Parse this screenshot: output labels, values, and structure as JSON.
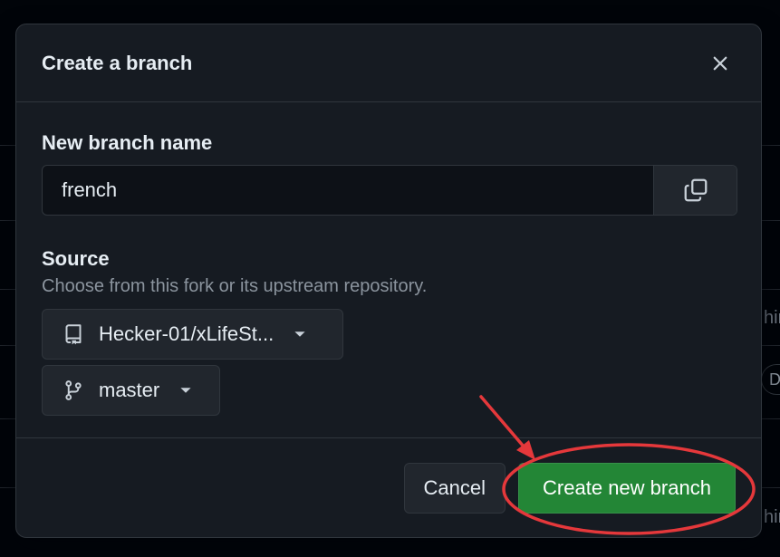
{
  "background": {
    "fragment_1": "hir",
    "fragment_2": "D",
    "fragment_3": "hir"
  },
  "dialog": {
    "title": "Create a branch",
    "close_icon": "x-icon"
  },
  "branch_name": {
    "label": "New branch name",
    "value": "french",
    "copy_icon": "copy-icon"
  },
  "source": {
    "label": "Source",
    "help": "Choose from this fork or its upstream repository.",
    "repo_select": "Hecker-01/xLifeSt...",
    "branch_select": "master"
  },
  "footer": {
    "cancel_label": "Cancel",
    "create_label": "Create new branch"
  },
  "colors": {
    "primary_button": "#238636",
    "annotation": "#e5383b"
  }
}
